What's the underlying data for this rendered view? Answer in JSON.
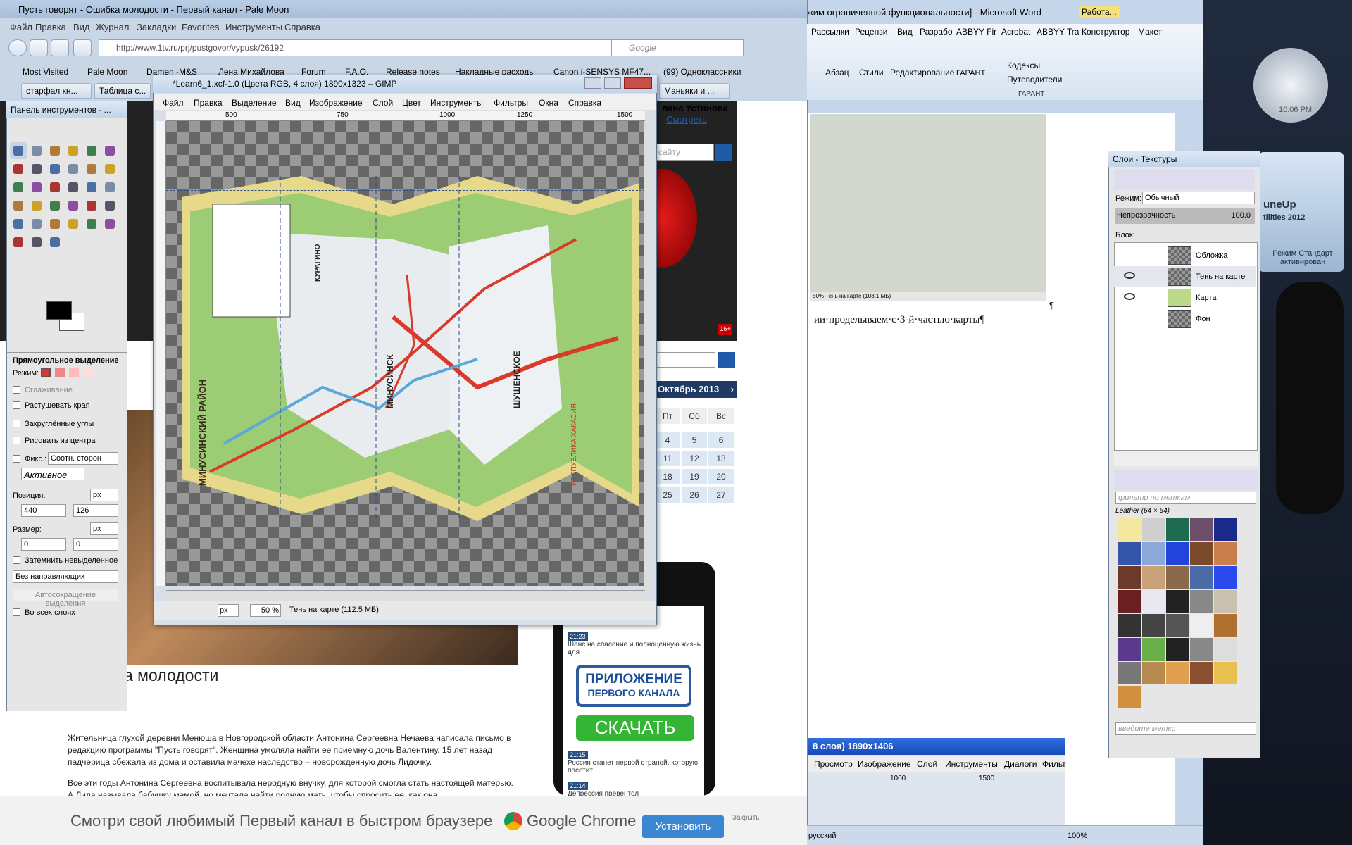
{
  "browser": {
    "title": "Пусть говорят - Ошибка молодости - Первый канал - Pale Moon",
    "menu": [
      "Файл",
      "Правка",
      "Вид",
      "Журнал",
      "Закладки",
      "Favorites",
      "Инструменты",
      "Справка"
    ],
    "url": "http://www.1tv.ru/prj/pustgovor/vypusk/26192",
    "search_placeholder": "Google",
    "bookmarks": [
      "Most Visited",
      "Pale Moon",
      "Damen -M&S",
      "Лена Михайлова",
      "Forum",
      "F.A.Q.",
      "Release notes",
      "Накладные расходы",
      "Canon i-SENSYS MF47...",
      "(99) Одноклассники"
    ],
    "tabs": [
      "старфал кн...",
      "Таблица с...",
      "Маньяки и ..."
    ],
    "page": {
      "user": "лана Устинова",
      "watch": "Смотреть",
      "search": "сайту",
      "calendar_month": "Октябрь 2013",
      "cal_days": [
        "Пт",
        "Сб",
        "Вс"
      ],
      "cal_rows": [
        [
          "4",
          "5",
          "6"
        ],
        [
          "11",
          "12",
          "13"
        ],
        [
          "18",
          "19",
          "20"
        ],
        [
          "25",
          "26",
          "27"
        ]
      ],
      "age": "16+",
      "article_title": "а молодости",
      "p1": "Жительница глухой деревни Менюша в Новгородской области Антонина Сергеевна Нечаева написала письмо в редакцию программы \"Пусть говорят\". Женщина умоляла найти ее приемную дочь Валентину. 15 лет назад падчерица сбежала из дома и оставила мачехе наследство – новорожденную дочь Лидочку.",
      "p2": "Все эти годы Антонина Сергеевна воспитывала неродную внучку, для которой смогла стать настоящей матерью. А Лида называла бабушку мамой, но мечтала найти родную мать, чтобы спросить ее, как она",
      "news": [
        {
          "time": "21:23",
          "text": "Шанс на спасение и полноценную жизнь для"
        },
        {
          "time": "21:15",
          "text": "Россия станет первой страной, которую посетит"
        },
        {
          "time": "21:14",
          "text": "Депрессия превентол"
        }
      ],
      "app_line1": "ПРИЛОЖЕНИЕ",
      "app_line2": "ПЕРВОГО КАНАЛА",
      "download": "СКАЧАТЬ"
    },
    "chrome_ad": {
      "text": "Смотри свой любимый Первый канал в быстром браузере",
      "brand": "Google Chrome",
      "install": "Установить",
      "close": "Закрыть"
    }
  },
  "gimp": {
    "title": "*Learn6_1.xcf-1.0 (Цвета RGB, 4 слоя) 1890x1323 – GIMP",
    "menu": [
      "Файл",
      "Правка",
      "Выделение",
      "Вид",
      "Изображение",
      "Слой",
      "Цвет",
      "Инструменты",
      "Фильтры",
      "Окна",
      "Справка"
    ],
    "ruler": [
      "500",
      "750",
      "1000",
      "1250",
      "1500"
    ],
    "unit": "px",
    "zoom": "50 %",
    "status": "Тень на карте (112.5 МБ)",
    "map_labels": [
      "МИНУСИНСКИЙ РАЙОН",
      "МИНУСИНСК",
      "КУРАГИНО",
      "ШУШЕНСКОЕ",
      "РЕСПУБЛИКА ХАКАСИЯ"
    ]
  },
  "toolbox": {
    "title": "Панель инструментов - ...",
    "tool_name": "Прямоугольное выделение",
    "mode": "Режим:",
    "antialias": "Сглаживание",
    "feather": "Растушевать края",
    "rounded": "Закруглённые углы",
    "center": "Рисовать из центра",
    "fixed": "Фикс.:",
    "fixed_value": "Соотн. сторон",
    "active": "Активное",
    "position": "Позиция:",
    "pos_unit": "px",
    "pos_x": "440",
    "pos_y": "126",
    "size": "Размер:",
    "size_unit": "px",
    "size_x": "0",
    "size_y": "0",
    "dim": "Затемнить невыделенное",
    "guides": "Без направляющих",
    "autoshrink": "Автосокращение выделения",
    "merged": "Во всех слоях"
  },
  "word": {
    "title": "жим ограниченной функциональности] - Microsoft Word",
    "context_tab": "Работа...",
    "tabs": [
      "Рассылки",
      "Рецензи",
      "Вид",
      "Разрабо",
      "ABBYY Fir",
      "Acrobat",
      "ABBYY Tra",
      "Конструктор",
      "Макет"
    ],
    "groups": [
      "Абзац",
      "Стили",
      "Редактирование",
      "ГАРАНТ"
    ],
    "garant_items": [
      "Кодексы",
      "Путеводители"
    ],
    "line": "ии·проделываем·с·3-й·частью·карты¶",
    "pilcrow": "¶",
    "mini_status": "50%",
    "mini_msg": "Тень на карте (103.1 МБ)",
    "status_lang": "русский",
    "status_zoom": "100%"
  },
  "gimp2": {
    "title": "8 слоя) 1890x1406",
    "menu": [
      "Просмотр",
      "Изображение",
      "Слой",
      "Инструменты",
      "Диалоги",
      "Фильт"
    ],
    "ruler": [
      "1000",
      "1500"
    ]
  },
  "layers": {
    "title": "Слои - Текстуры",
    "mode_label": "Режим:",
    "mode": "Обычный",
    "opacity_label": "Непрозрачность",
    "opacity": "100.0",
    "lock": "Блок:",
    "rows": [
      {
        "name": "Обложка",
        "visible": false
      },
      {
        "name": "Тень на карте",
        "visible": true
      },
      {
        "name": "Карта",
        "visible": true
      },
      {
        "name": "Фон",
        "visible": false
      }
    ],
    "filter_placeholder": "фильтр по меткам",
    "pattern_name": "Leather (64 × 64)",
    "tags_placeholder": "введите метки"
  },
  "desktop": {
    "clock_time": "10:06 PM",
    "tuneup1": "uneUp",
    "tuneup2": "tilities 2012",
    "tuneup_status": "Режим Стандарт активирован"
  }
}
